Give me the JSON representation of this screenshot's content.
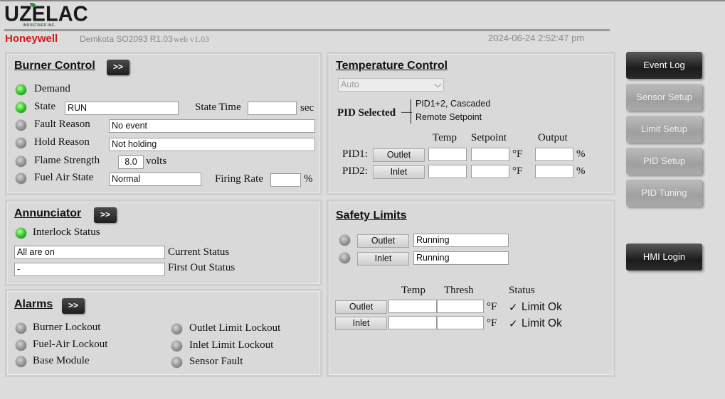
{
  "header": {
    "logo_text": "UZELAC",
    "logo_subtext": "INDUSTRIES INC.",
    "brand": "Honeywell",
    "model": "Demkota SO2093 R1.03",
    "web_version": "web v1.03",
    "datetime": "2024-06-24 2:52:47 pm"
  },
  "burner_control": {
    "title": "Burner Control",
    "go_label": ">>",
    "demand_label": "Demand",
    "state_label": "State",
    "state_value": "RUN",
    "state_time_label": "State Time",
    "state_time_value": "",
    "state_time_unit": "sec",
    "fault_reason_label": "Fault Reason",
    "fault_reason_value": "No event",
    "hold_reason_label": "Hold Reason",
    "hold_reason_value": "Not holding",
    "flame_strength_label": "Flame Strength",
    "flame_strength_value": "8.0",
    "flame_strength_unit": "volts",
    "fuel_air_state_label": "Fuel Air State",
    "fuel_air_state_value": "Normal",
    "firing_rate_label": "Firing Rate",
    "firing_rate_value": "",
    "firing_rate_unit": "%"
  },
  "annunciator": {
    "title": "Annunciator",
    "go_label": ">>",
    "interlock_label": "Interlock Status",
    "current_status_value": "All are on",
    "current_status_label": "Current Status",
    "first_out_value": "-",
    "first_out_label": "First Out Status"
  },
  "alarms": {
    "title": "Alarms",
    "go_label": ">>",
    "items": [
      "Burner Lockout",
      "Fuel-Air Lockout",
      "Base Module",
      "Outlet Limit Lockout",
      "Inlet Limit Lockout",
      "Sensor Fault"
    ]
  },
  "temperature_control": {
    "title": "Temperature Control",
    "mode_value": "Auto",
    "pid_selected_label": "PID Selected",
    "pid_selected_dash": "—",
    "pid_selected_line1": "PID1+2, Cascaded",
    "pid_selected_line2": "Remote Setpoint",
    "col_temp": "Temp",
    "col_setpoint": "Setpoint",
    "col_output": "Output",
    "rows": [
      {
        "label": "PID1:",
        "button": "Outlet",
        "temp": "",
        "setpoint": "",
        "temp_unit": "°F",
        "output": "",
        "output_unit": "%"
      },
      {
        "label": "PID2:",
        "button": "Inlet",
        "temp": "",
        "setpoint": "",
        "temp_unit": "°F",
        "output": "",
        "output_unit": "%"
      }
    ]
  },
  "safety_limits": {
    "title": "Safety Limits",
    "limits": [
      {
        "button": "Outlet",
        "status": "Running"
      },
      {
        "button": "Inlet",
        "status": "Running"
      }
    ],
    "col_temp": "Temp",
    "col_thresh": "Thresh",
    "col_status": "Status",
    "rows": [
      {
        "button": "Outlet",
        "temp": "",
        "thresh": "",
        "unit": "°F",
        "check": "✓",
        "status": "Limit Ok"
      },
      {
        "button": "Inlet",
        "temp": "",
        "thresh": "",
        "unit": "°F",
        "check": "✓",
        "status": "Limit Ok"
      }
    ]
  },
  "nav": {
    "event_log": "Event Log",
    "sensor_setup": "Sensor Setup",
    "limit_setup": "Limit Setup",
    "pid_setup": "PID Setup",
    "pid_tuning": "PID Tuning",
    "hmi_login": "HMI Login"
  },
  "colors": {
    "led_on": "#27c41f",
    "led_off": "#8c8c8c",
    "brand_red": "#d11a1a",
    "background": "#dcdcdc"
  }
}
